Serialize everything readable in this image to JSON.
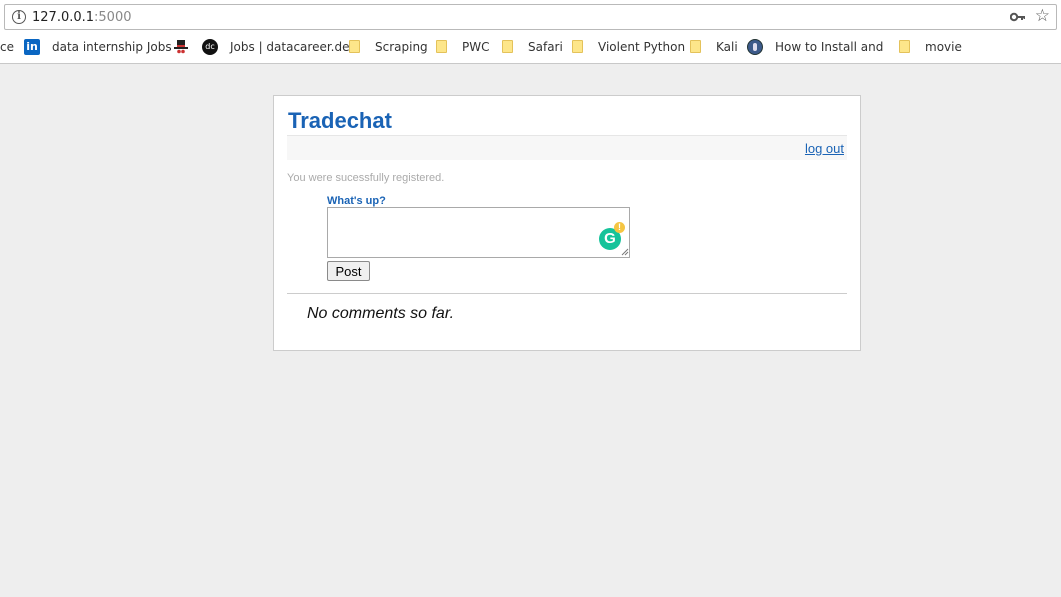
{
  "browser": {
    "url_host": "127.0.0.1",
    "url_port": ":5000",
    "bookmarks": [
      {
        "label": "ce",
        "icon": "none"
      },
      {
        "label": "data internship Jobs",
        "icon": "linkedin-icon"
      },
      {
        "label": "",
        "icon": "hat-icon"
      },
      {
        "label": "Jobs | datacareer.de",
        "icon": "datacareer-icon"
      },
      {
        "label": "Scraping",
        "icon": "folder-icon"
      },
      {
        "label": "PWC",
        "icon": "folder-icon"
      },
      {
        "label": "Safari",
        "icon": "folder-icon"
      },
      {
        "label": "Violent Python",
        "icon": "folder-icon"
      },
      {
        "label": "Kali",
        "icon": "folder-icon"
      },
      {
        "label": "How to Install and C",
        "icon": "globe-icon"
      },
      {
        "label": "movie",
        "icon": "folder-icon"
      }
    ]
  },
  "app": {
    "title": "Tradechat",
    "logout_label": "log out",
    "flash_message": "You were sucessfully registered.",
    "compose_label": "What's up?",
    "compose_value": "",
    "post_label": "Post",
    "empty_message": "No comments so far."
  },
  "icons": {
    "grammarly_letter": "G",
    "grammarly_badge": "!"
  },
  "colors": {
    "accent": "#1a63b5",
    "background": "#eeeeee",
    "grammarly": "#15c39a"
  }
}
